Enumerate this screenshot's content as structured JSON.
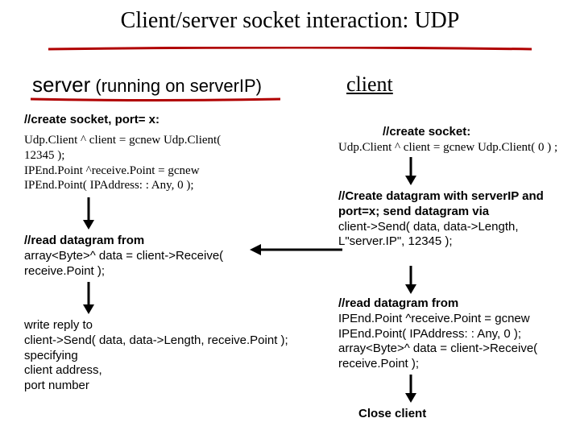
{
  "title": "Client/server socket interaction: UDP",
  "server_header": {
    "srv": "server",
    "running": " (running on serverIP)"
  },
  "client_header": "client",
  "server": {
    "s1": "//create socket, port= x:",
    "s2a": "Udp.Client ^ client = gcnew Udp.Client( 12345 );",
    "s2b": "IPEnd.Point ^receive.Point = gcnew IPEnd.Point( IPAddress: : Any, 0 );",
    "s3a": "//read datagram from",
    "s3b": "array<Byte>^ data = client->Receive( receive.Point );",
    "s4a": "write reply to",
    "s4b": "client->Send( data, data->Length, receive.Point );",
    "s4c": "specifying\nclient address,\nport number"
  },
  "client": {
    "c1": "//create socket:",
    "c1b": "Udp.Client ^ client = gcnew Udp.Client( 0 ) ;",
    "c2a": "//Create datagram with serverIP and port=x; send datagram via",
    "c2b": "client->Send( data, data->Length, L\"server.IP\", 12345 );",
    "c3a": "//read datagram from",
    "c3b": "IPEnd.Point ^receive.Point = gcnew IPEnd.Point( IPAddress: : Any, 0 );",
    "c3c": "array<Byte>^ data = client->Receive( receive.Point );",
    "c4": "Close client"
  }
}
